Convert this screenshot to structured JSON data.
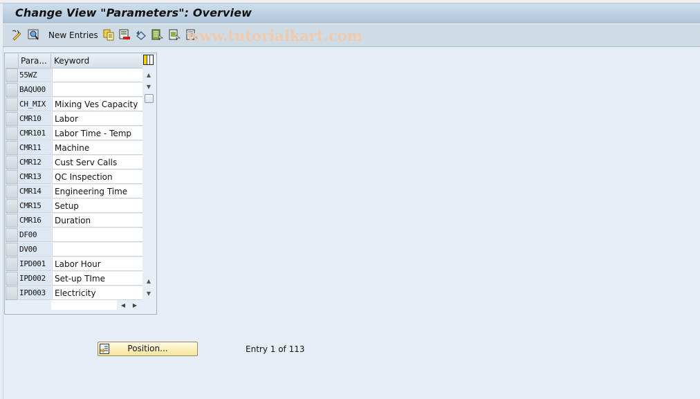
{
  "window": {
    "title": "Change View \"Parameters\": Overview"
  },
  "toolbar": {
    "items": [
      {
        "icon": "display-change-icon"
      },
      {
        "icon": "details-icon"
      },
      {
        "label": "New Entries"
      },
      {
        "icon": "copy-as-icon"
      },
      {
        "icon": "delete-icon"
      },
      {
        "icon": "undo-change-icon"
      },
      {
        "icon": "select-all-icon"
      },
      {
        "icon": "select-block-icon"
      },
      {
        "icon": "deselect-all-icon"
      }
    ],
    "new_entries_label": "New Entries"
  },
  "watermark": "www.tutorialkart.com",
  "table": {
    "columns": [
      "Para...",
      "Keyword"
    ],
    "rows": [
      {
        "param": "55WZ",
        "keyword": ""
      },
      {
        "param": "BAQU00",
        "keyword": ""
      },
      {
        "param": "CH_MIX",
        "keyword": "Mixing Ves Capacity"
      },
      {
        "param": "CMR10",
        "keyword": "Labor"
      },
      {
        "param": "CMR101",
        "keyword": "Labor Time - Temp"
      },
      {
        "param": "CMR11",
        "keyword": "Machine"
      },
      {
        "param": "CMR12",
        "keyword": "Cust Serv Calls"
      },
      {
        "param": "CMR13",
        "keyword": "QC Inspection"
      },
      {
        "param": "CMR14",
        "keyword": "Engineering Time"
      },
      {
        "param": "CMR15",
        "keyword": "Setup"
      },
      {
        "param": "CMR16",
        "keyword": "Duration"
      },
      {
        "param": "DF00",
        "keyword": ""
      },
      {
        "param": "DV00",
        "keyword": ""
      },
      {
        "param": "IPD001",
        "keyword": "Labor Hour"
      },
      {
        "param": "IPD002",
        "keyword": "Set-up TIme"
      },
      {
        "param": "IPD003",
        "keyword": "Electricity"
      }
    ]
  },
  "footer": {
    "position_button": "Position...",
    "entry_text": "Entry 1 of 113"
  }
}
